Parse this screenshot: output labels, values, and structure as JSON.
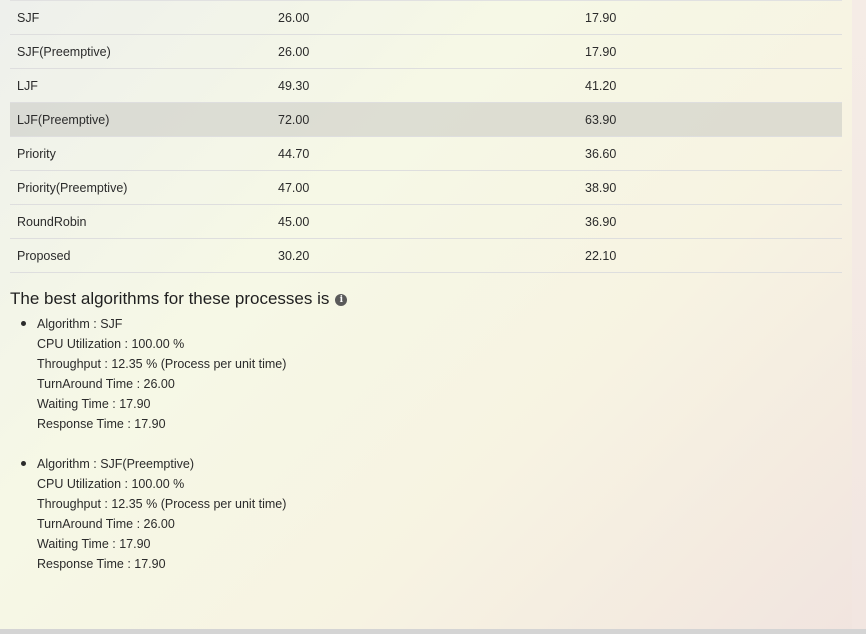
{
  "table": {
    "rows": [
      {
        "name": "SJF",
        "a": "26.00",
        "b": "17.90",
        "highlight": false
      },
      {
        "name": "SJF(Preemptive)",
        "a": "26.00",
        "b": "17.90",
        "highlight": false
      },
      {
        "name": "LJF",
        "a": "49.30",
        "b": "41.20",
        "highlight": false
      },
      {
        "name": "LJF(Preemptive)",
        "a": "72.00",
        "b": "63.90",
        "highlight": true
      },
      {
        "name": "Priority",
        "a": "44.70",
        "b": "36.60",
        "highlight": false
      },
      {
        "name": "Priority(Preemptive)",
        "a": "47.00",
        "b": "38.90",
        "highlight": false
      },
      {
        "name": "RoundRobin",
        "a": "45.00",
        "b": "36.90",
        "highlight": false
      },
      {
        "name": "Proposed",
        "a": "30.20",
        "b": "22.10",
        "highlight": false
      }
    ]
  },
  "best": {
    "title": "The best algorithms for these processes is",
    "info_icon": "info-circle-icon",
    "items": [
      {
        "algorithm": "Algorithm : SJF",
        "cpu": "CPU Utilization : 100.00 %",
        "throughput": "Throughput : 12.35 % (Process per unit time)",
        "turnaround": "TurnAround Time : 26.00",
        "waiting": "Waiting Time : 17.90",
        "response": "Response Time : 17.90"
      },
      {
        "algorithm": "Algorithm : SJF(Preemptive)",
        "cpu": "CPU Utilization : 100.00 %",
        "throughput": "Throughput : 12.35 % (Process per unit time)",
        "turnaround": "TurnAround Time : 26.00",
        "waiting": "Waiting Time : 17.90",
        "response": "Response Time : 17.90"
      }
    ]
  }
}
